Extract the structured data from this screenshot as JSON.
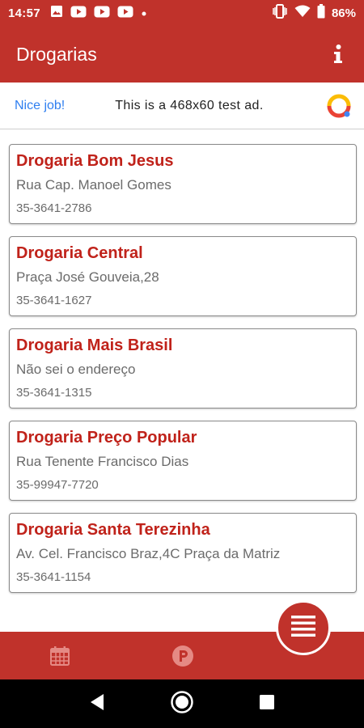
{
  "status_bar": {
    "time": "14:57",
    "battery_pct": "86%",
    "notification_icons": [
      "image-icon",
      "youtube-icon",
      "youtube-icon",
      "youtube-icon",
      "dot-icon"
    ],
    "system_icons": [
      "vibrate-icon",
      "wifi-icon",
      "battery-icon"
    ]
  },
  "app_bar": {
    "title": "Drogarias",
    "action_icon": "info-icon"
  },
  "ad_banner": {
    "nice_text": "Nice job!",
    "ad_text": "This is a 468x60 test ad.",
    "logo_icon": "ad-logo-icon"
  },
  "pharmacies": [
    {
      "name": "Drogaria Bom Jesus",
      "address": "Rua Cap. Manoel Gomes",
      "phone": "35-3641-2786"
    },
    {
      "name": "Drogaria Central",
      "address": "Praça José Gouveia,28",
      "phone": "35-3641-1627"
    },
    {
      "name": "Drogaria Mais Brasil",
      "address": "Não sei o endereço",
      "phone": "35-3641-1315"
    },
    {
      "name": "Drogaria Preço Popular",
      "address": "Rua Tenente Francisco Dias",
      "phone": "35-99947-7720"
    },
    {
      "name": "Drogaria Santa Terezinha",
      "address": "Av. Cel. Francisco Braz,4C Praça da Matriz",
      "phone": "35-3641-1154"
    }
  ],
  "bottom_nav": {
    "items": [
      "calendar-icon",
      "parking-icon"
    ],
    "fab_icon": "list-icon"
  },
  "system_nav": [
    "back-icon",
    "home-icon",
    "recents-icon"
  ],
  "colors": {
    "primary": "#c0322b",
    "card_title": "#c0221a",
    "ad_link": "#2f7ff0"
  }
}
